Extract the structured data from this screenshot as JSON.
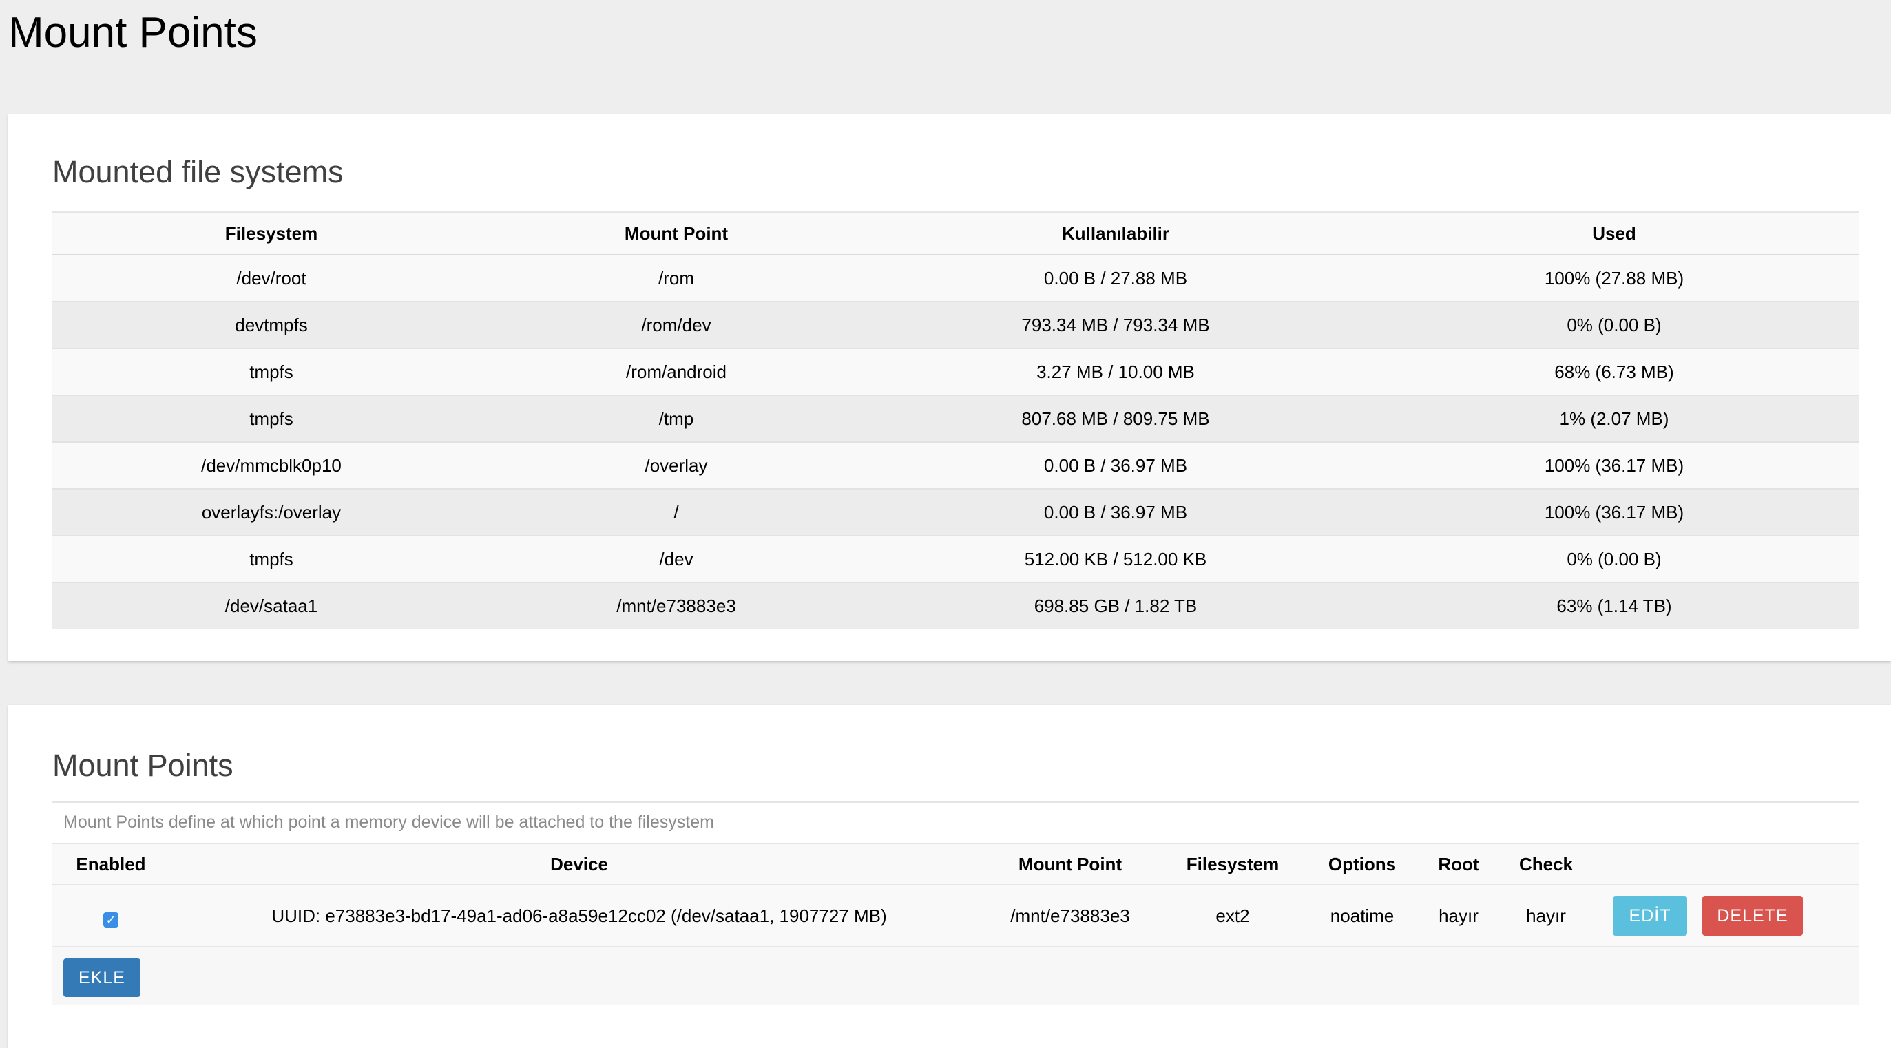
{
  "page": {
    "title": "Mount Points"
  },
  "mounted_fs": {
    "title": "Mounted file systems",
    "columns": [
      "Filesystem",
      "Mount Point",
      "Kullanılabilir",
      "Used"
    ],
    "rows": [
      [
        "/dev/root",
        "/rom",
        "0.00 B / 27.88 MB",
        "100% (27.88 MB)"
      ],
      [
        "devtmpfs",
        "/rom/dev",
        "793.34 MB / 793.34 MB",
        "0% (0.00 B)"
      ],
      [
        "tmpfs",
        "/rom/android",
        "3.27 MB / 10.00 MB",
        "68% (6.73 MB)"
      ],
      [
        "tmpfs",
        "/tmp",
        "807.68 MB / 809.75 MB",
        "1% (2.07 MB)"
      ],
      [
        "/dev/mmcblk0p10",
        "/overlay",
        "0.00 B / 36.97 MB",
        "100% (36.17 MB)"
      ],
      [
        "overlayfs:/overlay",
        "/",
        "0.00 B / 36.97 MB",
        "100% (36.17 MB)"
      ],
      [
        "tmpfs",
        "/dev",
        "512.00 KB / 512.00 KB",
        "0% (0.00 B)"
      ],
      [
        "/dev/sataa1",
        "/mnt/e73883e3",
        "698.85 GB / 1.82 TB",
        "63% (1.14 TB)"
      ]
    ]
  },
  "mount_points": {
    "title": "Mount Points",
    "description": "Mount Points define at which point a memory device will be attached to the filesystem",
    "columns": [
      "Enabled",
      "Device",
      "Mount Point",
      "Filesystem",
      "Options",
      "Root",
      "Check",
      ""
    ],
    "rows": [
      {
        "enabled": true,
        "device": "UUID: e73883e3-bd17-49a1-ad06-a8a59e12cc02 (/dev/sataa1, 1907727 MB)",
        "mount_point": "/mnt/e73883e3",
        "filesystem": "ext2",
        "options": "noatime",
        "root": "hayır",
        "check": "hayır",
        "edit_label": "EDİT",
        "delete_label": "DELETE"
      }
    ],
    "add_label": "EKLE"
  },
  "colors": {
    "edit": "#5bc0de",
    "delete": "#d9534f",
    "add": "#337ab7",
    "checkbox": "#3a8ee6"
  },
  "icons": {
    "enabled_checkbox": "checkmark-icon"
  }
}
